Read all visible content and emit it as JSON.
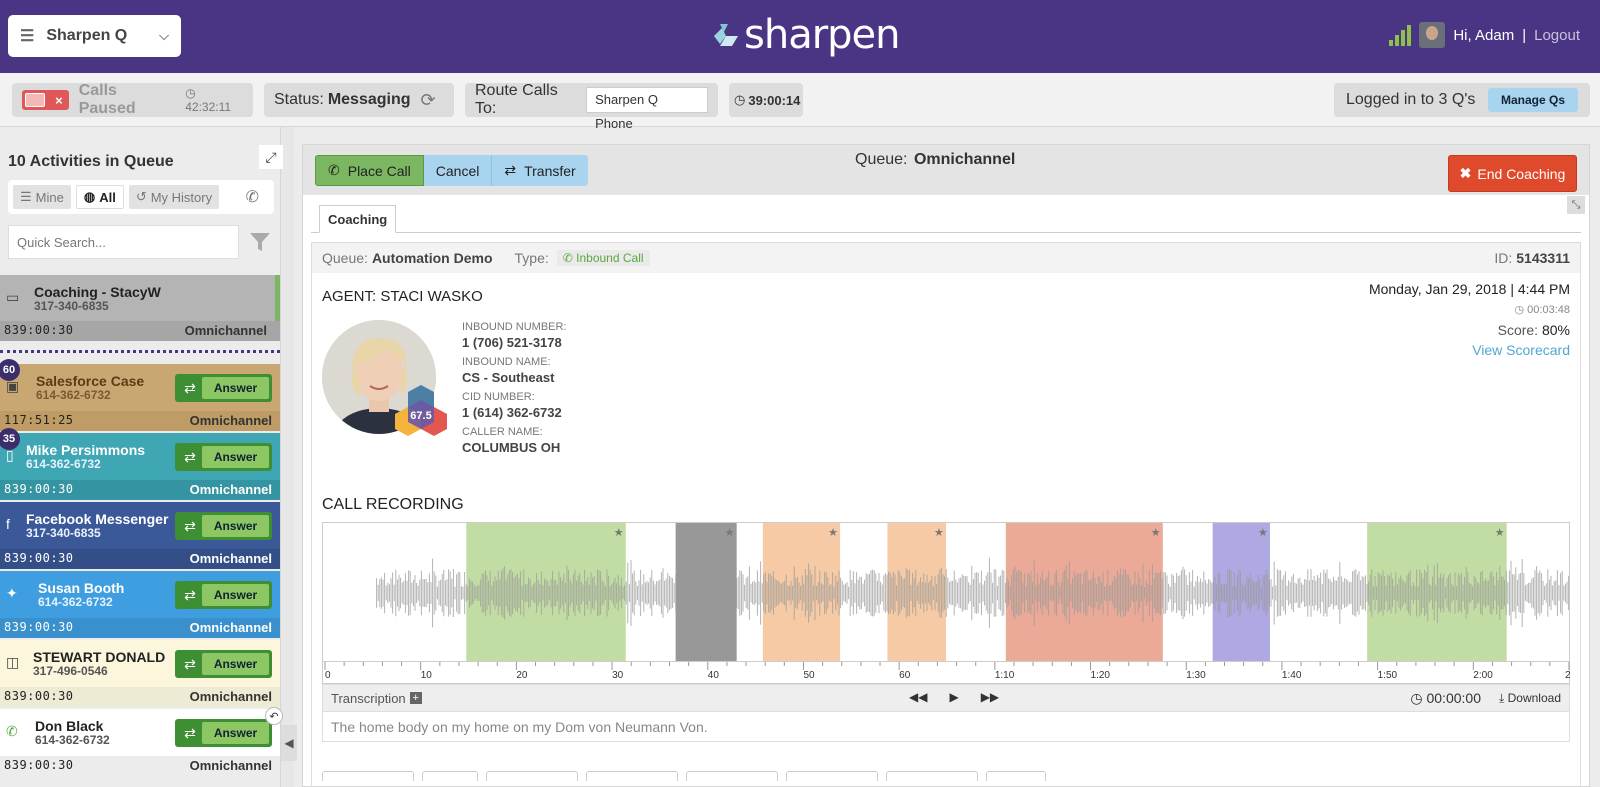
{
  "header": {
    "app_name": "Sharpen Q",
    "logo_text": "sharpen",
    "greeting": "Hi, Adam",
    "separator": "|",
    "logout": "Logout"
  },
  "statusbar": {
    "paused_label": "Calls Paused",
    "paused_timer": "42:32:11",
    "toggle_x": "×",
    "status_label": "Status:",
    "status_value": "Messaging",
    "route_label": "Route Calls To:",
    "route_value": "Sharpen Q Phone",
    "clock": "39:00:14",
    "logged_in": "Logged in to 3 Q's",
    "manage": "Manage Qs"
  },
  "queue_panel": {
    "title": "10 Activities in Queue",
    "tabs": [
      {
        "label": "Mine",
        "icon": "list-icon"
      },
      {
        "label": "All",
        "icon": "globe-icon"
      },
      {
        "label": "My History",
        "icon": "history-icon"
      }
    ],
    "search_placeholder": "Quick Search...",
    "answer_label": "Answer",
    "cards": [
      {
        "name": "Coaching - StacyW",
        "phone": "317-340-6835",
        "time": "839:00:30",
        "queue": "Omnichannel",
        "bg": "#b4b4b4",
        "footer": "#a6a6a6",
        "text": "#222",
        "icon": "coaching-icon",
        "badge": "",
        "answer": false
      },
      {
        "name": "Salesforce Case",
        "phone": "614-362-6732",
        "time": "117:51:25",
        "queue": "Omnichannel",
        "bg": "#c8a772",
        "footer": "#bf9c66",
        "text": "#5a3d14",
        "icon": "salesforce-icon",
        "badge": "60",
        "answer": true
      },
      {
        "name": "Mike Persimmons",
        "phone": "614-362-6732",
        "time": "839:00:30",
        "queue": "Omnichannel",
        "bg": "#3fa6b4",
        "footer": "#3594a1",
        "text": "#fff",
        "icon": "mobile-icon",
        "badge": "35",
        "answer": true
      },
      {
        "name": "Facebook Messenger",
        "phone": "317-340-6835",
        "time": "839:00:30",
        "queue": "Omnichannel",
        "bg": "#3b5998",
        "footer": "#344f88",
        "text": "#fff",
        "icon": "facebook-icon",
        "badge": "",
        "answer": true
      },
      {
        "name": "Susan Booth",
        "phone": "614-362-6732",
        "time": "839:00:30",
        "queue": "Omnichannel",
        "bg": "#3f9ee0",
        "footer": "#3a90cc",
        "text": "#fff",
        "icon": "twitter-icon",
        "badge": "",
        "answer": true
      },
      {
        "name": "STEWART DONALD",
        "phone": "317-496-0546",
        "time": "839:00:30",
        "queue": "Omnichannel",
        "bg": "#fbf6dc",
        "footer": "#eeebd4",
        "text": "#222",
        "icon": "voicemail-icon",
        "badge": "",
        "answer": true
      },
      {
        "name": "Don Black",
        "phone": "614-362-6732",
        "time": "839:00:30",
        "queue": "Omnichannel",
        "bg": "#ffffff",
        "footer": "#ececec",
        "text": "#222",
        "icon": "phone-icon",
        "badge": "",
        "answer": true
      }
    ]
  },
  "main": {
    "place_call": "Place Call",
    "cancel": "Cancel",
    "transfer": "Transfer",
    "queue_label": "Queue:",
    "queue_name": "Omnichannel",
    "end_coaching": "End Coaching",
    "tab": "Coaching",
    "meta": {
      "queue_label": "Queue:",
      "queue_value": "Automation Demo",
      "type_label": "Type:",
      "type_value": "Inbound Call",
      "id_label": "ID:",
      "id_value": "5143311"
    },
    "agent": "AGENT: STACI WASKO",
    "agent_score": "67.5",
    "fields": [
      {
        "label": "INBOUND NUMBER:",
        "value": "1 (706) 521-3178"
      },
      {
        "label": "INBOUND NAME:",
        "value": "CS - Southeast"
      },
      {
        "label": "CID NUMBER:",
        "value": "1 (614) 362-6732"
      },
      {
        "label": "CALLER NAME:",
        "value": "COLUMBUS OH"
      }
    ],
    "date": "Monday, Jan 29, 2018 | 4:44 PM",
    "duration": "00:03:48",
    "score_label": "Score:",
    "score_value": "80%",
    "view_scorecard": "View Scorecard",
    "recording_title": "CALL RECORDING",
    "ticks": [
      "0",
      "10",
      "20",
      "30",
      "40",
      "50",
      "60",
      "1:10",
      "1:20",
      "1:30",
      "1:40",
      "1:50",
      "2:00",
      "2"
    ],
    "segments": [
      {
        "color": "#a8cf7c",
        "start": 0.115,
        "end": 0.243
      },
      {
        "color": "#6c6c6c",
        "start": 0.283,
        "end": 0.332
      },
      {
        "color": "#f2b47e",
        "start": 0.353,
        "end": 0.415
      },
      {
        "color": "#f2b47e",
        "start": 0.453,
        "end": 0.5
      },
      {
        "color": "#e3866c",
        "start": 0.548,
        "end": 0.674
      },
      {
        "color": "#8c84d6",
        "start": 0.714,
        "end": 0.76
      },
      {
        "color": "#a8cf7c",
        "start": 0.838,
        "end": 0.95
      }
    ],
    "transcription_label": "Transcription",
    "player_time": "00:00:00",
    "download": "Download",
    "transcript_text": "The home body on my home on my Dom von Neumann Von."
  }
}
